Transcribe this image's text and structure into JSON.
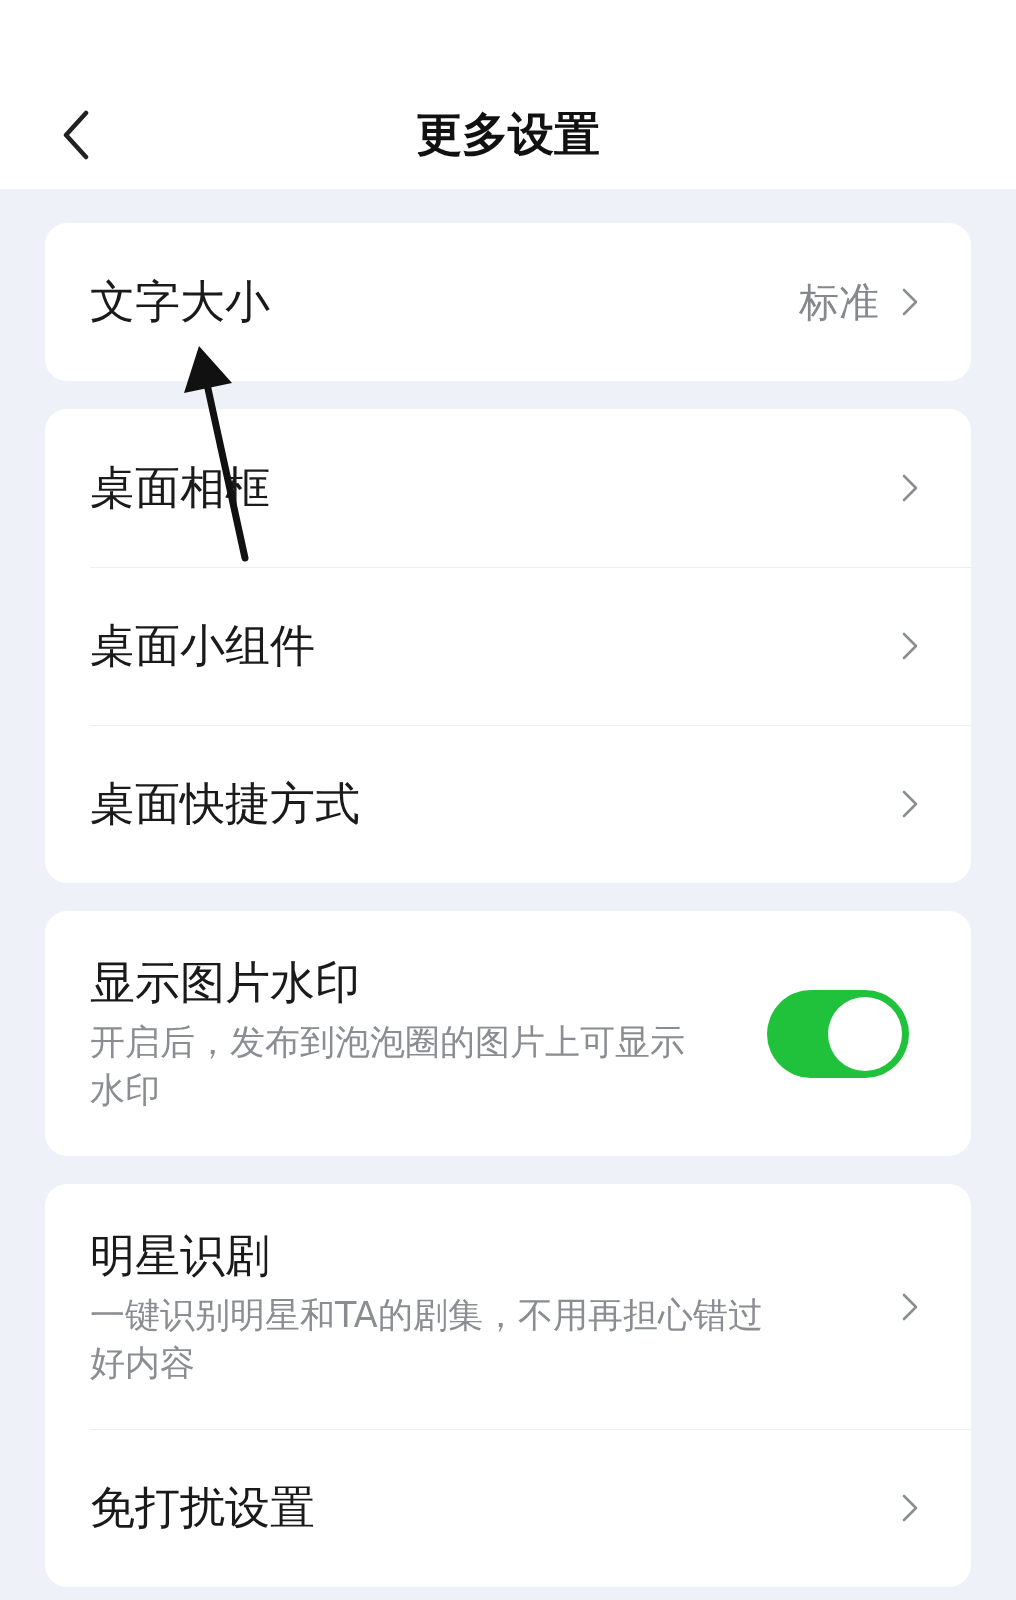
{
  "header": {
    "title": "更多设置"
  },
  "groups": [
    {
      "items": [
        {
          "kind": "link",
          "label": "文字大小",
          "value": "标准"
        }
      ]
    },
    {
      "items": [
        {
          "kind": "link",
          "label": "桌面相框"
        },
        {
          "kind": "link",
          "label": "桌面小组件"
        },
        {
          "kind": "link",
          "label": "桌面快捷方式"
        }
      ]
    },
    {
      "items": [
        {
          "kind": "toggle",
          "label": "显示图片水印",
          "description": "开启后，发布到泡泡圈的图片上可显示水印",
          "on": true
        }
      ]
    },
    {
      "items": [
        {
          "kind": "link",
          "label": "明星识剧",
          "description": "一键识别明星和TA的剧集，不用再担心错过好内容"
        },
        {
          "kind": "link",
          "label": "免打扰设置"
        }
      ]
    }
  ]
}
